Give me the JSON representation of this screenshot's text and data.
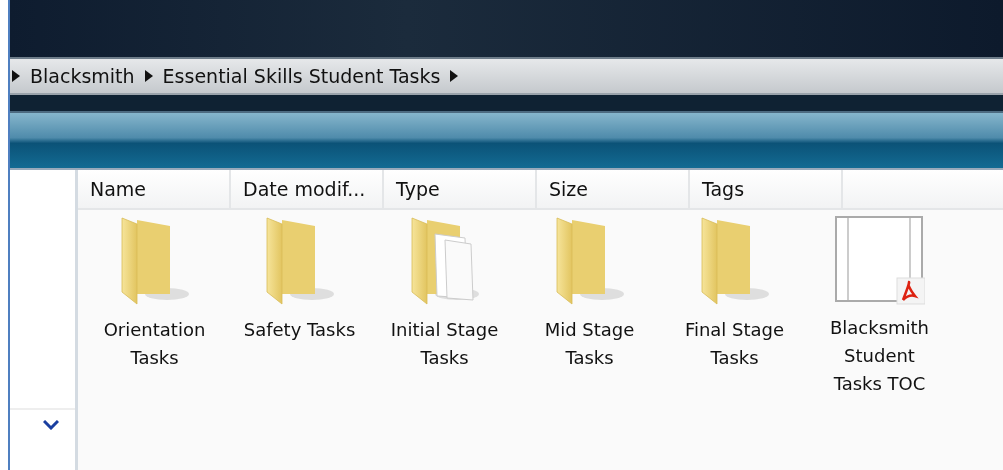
{
  "breadcrumb": [
    "Blacksmith",
    "Essential Skills Student Tasks"
  ],
  "columns": [
    "Name",
    "Date modif...",
    "Type",
    "Size",
    "Tags"
  ],
  "items": [
    {
      "kind": "folder",
      "label": "Orientation Tasks"
    },
    {
      "kind": "folder",
      "label": "Safety Tasks"
    },
    {
      "kind": "folder-docs",
      "label": "Initial Stage Tasks"
    },
    {
      "kind": "folder",
      "label": "Mid Stage Tasks"
    },
    {
      "kind": "folder",
      "label": "Final Stage Tasks"
    },
    {
      "kind": "pdf",
      "label": "Blacksmith Student Tasks TOC"
    }
  ]
}
